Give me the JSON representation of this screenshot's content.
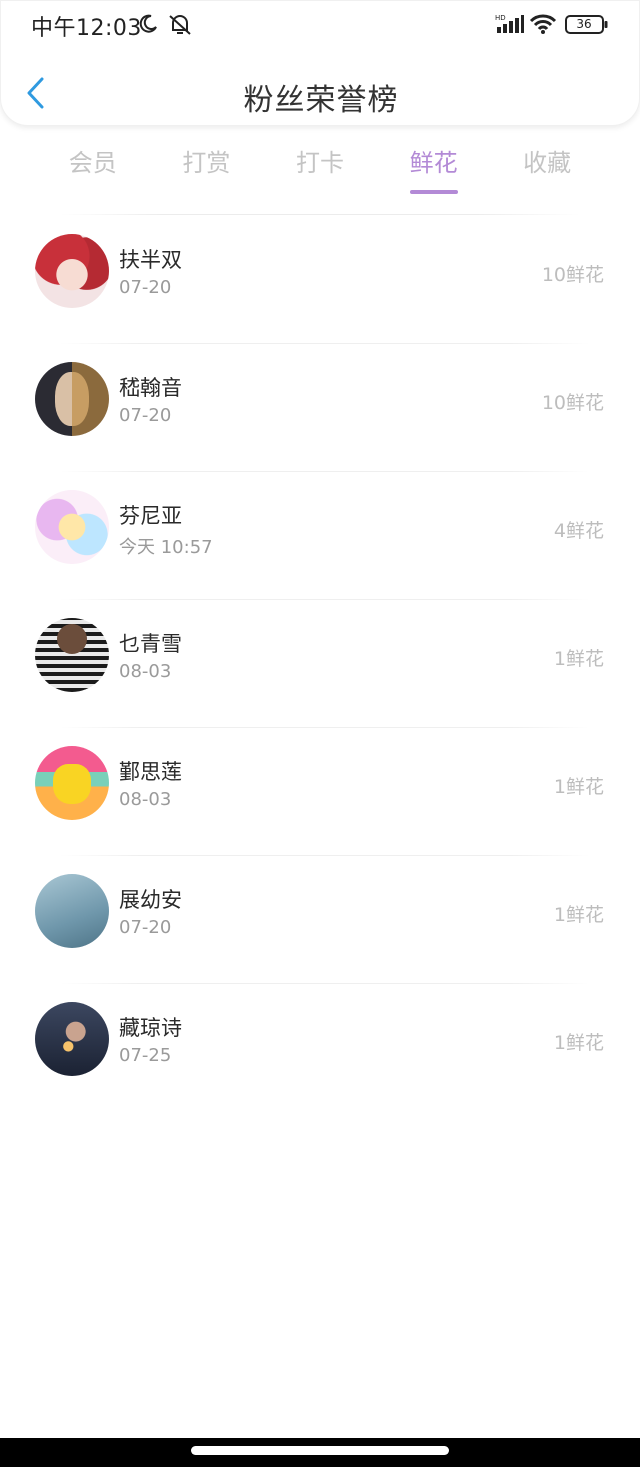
{
  "status_bar": {
    "time": "中午12:03",
    "battery": "36",
    "icons": [
      "moon-icon",
      "alarm-off-icon",
      "hd-signal-icon",
      "wifi-icon",
      "battery-icon"
    ]
  },
  "header": {
    "title": "粉丝荣誉榜",
    "back_icon": "chevron-left-icon"
  },
  "tabs": [
    {
      "label": "会员",
      "active": false
    },
    {
      "label": "打赏",
      "active": false
    },
    {
      "label": "打卡",
      "active": false
    },
    {
      "label": "鲜花",
      "active": true
    },
    {
      "label": "收藏",
      "active": false
    }
  ],
  "list": [
    {
      "name": "扶半双",
      "date": "07-20",
      "count": "10鲜花"
    },
    {
      "name": "嵇翰音",
      "date": "07-20",
      "count": "10鲜花"
    },
    {
      "name": "芬尼亚",
      "date": "今天 10:57",
      "count": "4鲜花"
    },
    {
      "name": "乜青雪",
      "date": "08-03",
      "count": "1鲜花"
    },
    {
      "name": "鄞思莲",
      "date": "08-03",
      "count": "1鲜花"
    },
    {
      "name": "展幼安",
      "date": "07-20",
      "count": "1鲜花"
    },
    {
      "name": "藏琼诗",
      "date": "07-25",
      "count": "1鲜花"
    }
  ],
  "colors": {
    "accent": "#b38ad6",
    "back_icon": "#2f9ae0",
    "inactive_tab": "#c4c4c4",
    "count_text": "#bdbdbd"
  }
}
